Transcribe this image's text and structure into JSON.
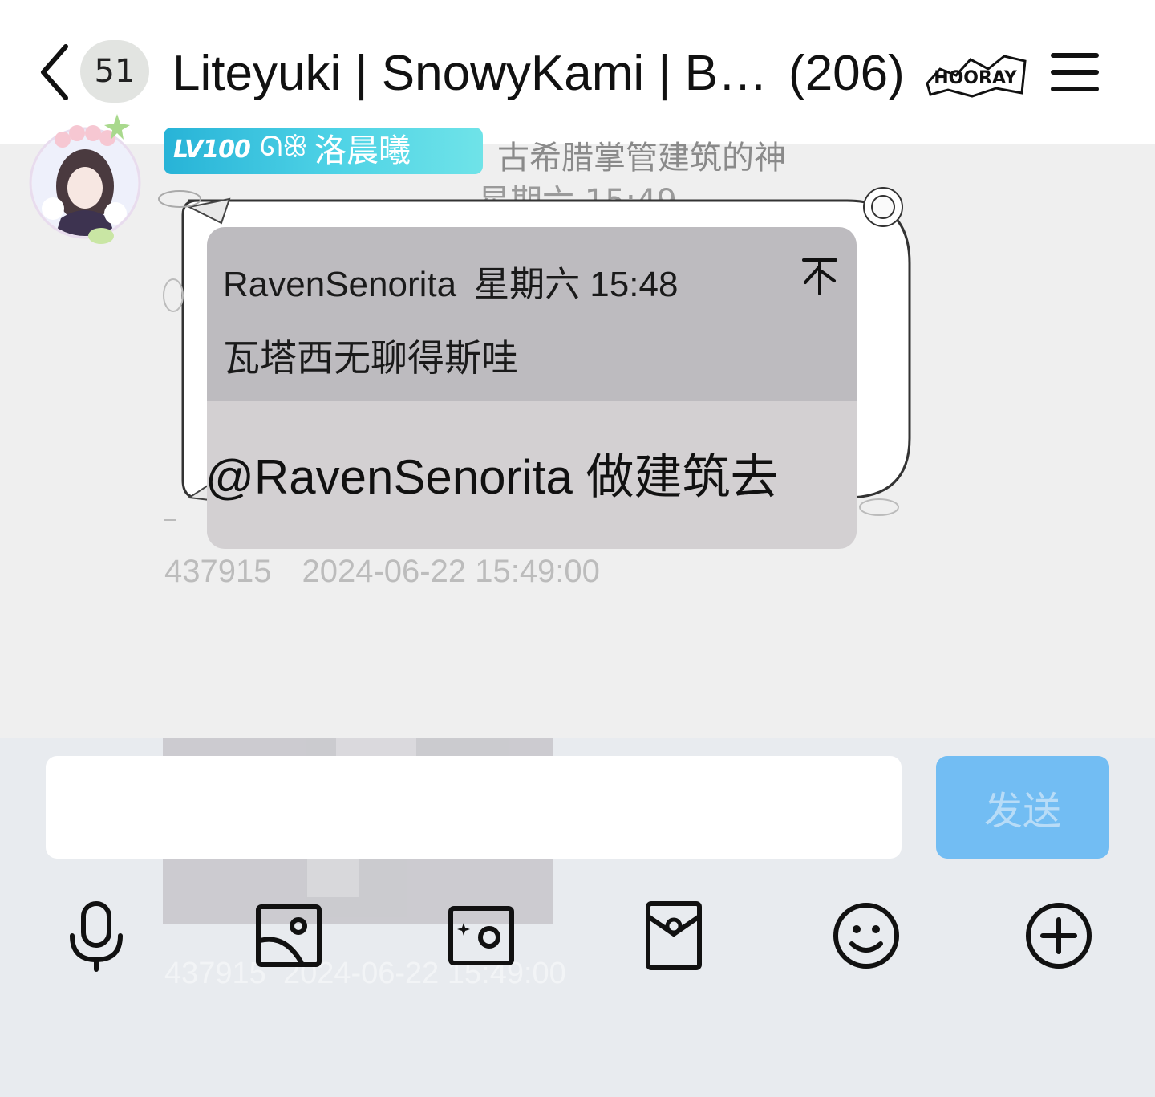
{
  "header": {
    "unread_count": "51",
    "title": "Liteyuki | SnowyKami | B…",
    "member_count": "(206)",
    "badge_text": "HOORAY"
  },
  "chat": {
    "time_divider": "星期六 15:49",
    "message": {
      "level": "LV100",
      "nickname": "洛晨曦",
      "deco_left": "ᘏꕥ",
      "deco_right": "ꕥᘏ",
      "member_title": "古希腊掌管建筑的神",
      "quote": {
        "author": "RavenSenorita",
        "time": "星期六 15:48",
        "text": "瓦塔西无聊得斯哇"
      },
      "text": "@RavenSenorita 做建筑去",
      "sender_id": "437915",
      "datetime": "2024-06-22 15:49:00"
    },
    "next_message_ghost": {
      "sender_id": "437915",
      "datetime": "2024-06-22 15:49:00"
    }
  },
  "composer": {
    "input_value": "",
    "input_placeholder": "",
    "send_label": "发送",
    "tools": [
      "microphone-icon",
      "image-icon",
      "camera-icon",
      "red-packet-icon",
      "emoji-icon",
      "plus-icon"
    ]
  },
  "colors": {
    "header_bg": "#ffffff",
    "chat_bg": "#efefef",
    "composer_bg": "#e8ebef",
    "send_button": "#72bdf3",
    "level_tag": "#27b3d7"
  }
}
